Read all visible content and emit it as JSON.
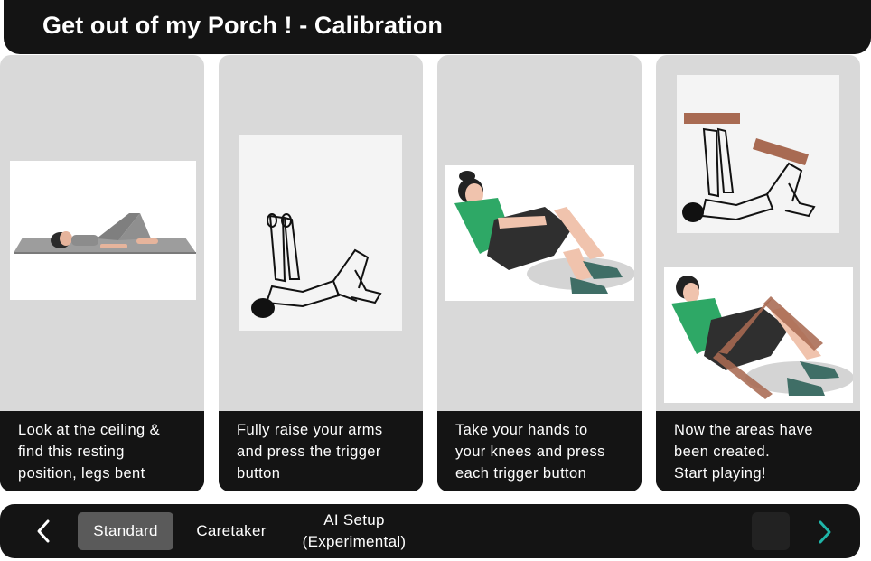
{
  "app": {
    "title": "Get out of my Porch ! - Calibration"
  },
  "colors": {
    "accent": "#1fb5a8",
    "panel": "#141414",
    "card": "#d9d9d9",
    "active_tab": "#5a5a5a"
  },
  "steps": [
    {
      "lines": [
        "Look at the ceiling &",
        "find this resting",
        "position, legs bent"
      ],
      "image": "person-lying-legs-bent"
    },
    {
      "lines": [
        "Fully raise your arms",
        "and press the trigger",
        "button"
      ],
      "image": "person-arms-raised-sketch"
    },
    {
      "lines": [
        "Take your hands to",
        "your knees and press",
        "each trigger button"
      ],
      "image": "person-hands-on-knees"
    },
    {
      "lines": [
        "Now the areas have",
        "been created.",
        "Start playing!"
      ],
      "image": "calibration-areas-overlay"
    }
  ],
  "nav": {
    "prev_icon": "chevron-left-icon",
    "next_icon": "chevron-right-icon",
    "tabs": [
      {
        "label": "Standard",
        "active": true
      },
      {
        "label": "Caretaker",
        "active": false
      },
      {
        "label_lines": [
          "AI Setup",
          "(Experimental)"
        ],
        "active": false
      }
    ]
  }
}
